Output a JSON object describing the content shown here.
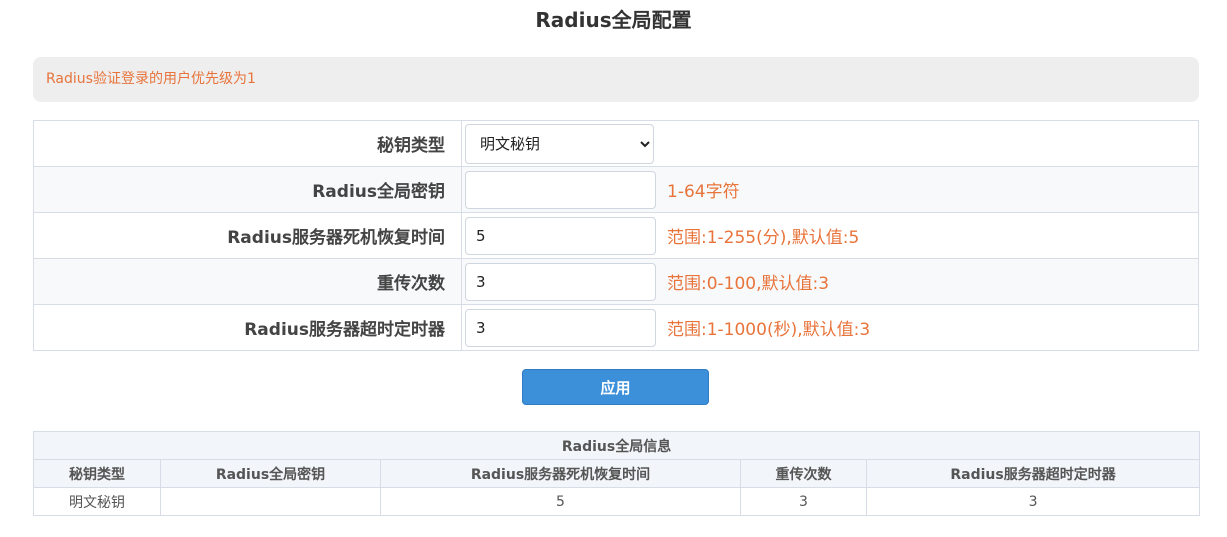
{
  "page": {
    "title": "Radius全局配置"
  },
  "notice": {
    "text": "Radius验证登录的用户优先级为1"
  },
  "form": {
    "rows": [
      {
        "label": "秘钥类型",
        "type": "select",
        "value": "明文秘钥",
        "options": [
          "明文秘钥"
        ],
        "hint": ""
      },
      {
        "label": "Radius全局密钥",
        "type": "input",
        "value": "",
        "hint": "1-64字符"
      },
      {
        "label": "Radius服务器死机恢复时间",
        "type": "input",
        "value": "5",
        "hint": "范围:1-255(分),默认值:5"
      },
      {
        "label": "重传次数",
        "type": "input",
        "value": "3",
        "hint": "范围:0-100,默认值:3"
      },
      {
        "label": "Radius服务器超时定时器",
        "type": "input",
        "value": "3",
        "hint": "范围:1-1000(秒),默认值:3"
      }
    ]
  },
  "apply_button": {
    "label": "应用"
  },
  "info_table": {
    "title": "Radius全局信息",
    "headers": [
      "秘钥类型",
      "Radius全局密钥",
      "Radius服务器死机恢复时间",
      "重传次数",
      "Radius服务器超时定时器"
    ],
    "rows": [
      [
        "明文秘钥",
        "",
        "5",
        "3",
        "3"
      ]
    ]
  },
  "colors": {
    "accent": "#3c8fd9",
    "hint": "#e8743b",
    "notice_bg": "#eeeeee"
  }
}
